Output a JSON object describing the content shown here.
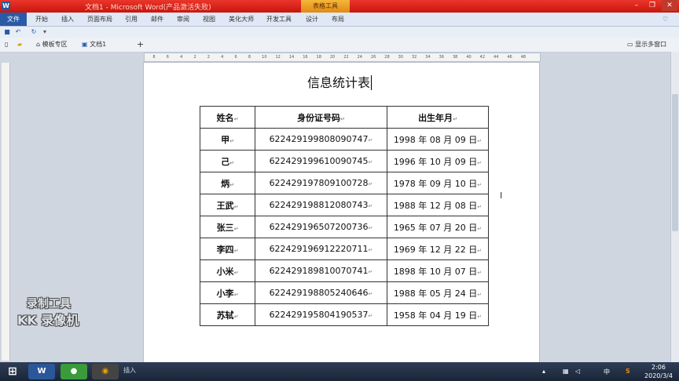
{
  "window": {
    "title": "文档1 - Microsoft Word(产品激活失败)",
    "context_tab": "表格工具"
  },
  "ribbon": {
    "file": "文件",
    "tabs": [
      "开始",
      "插入",
      "页面布局",
      "引用",
      "邮件",
      "审阅",
      "视图",
      "美化大师",
      "开发工具",
      "设计",
      "布局"
    ]
  },
  "doc_tabs": {
    "template": "模板专区",
    "doc": "文档1",
    "add": "+",
    "multi_window": "显示多窗口"
  },
  "ruler": {
    "numbers": [
      "8",
      "6",
      "4",
      "2",
      "2",
      "4",
      "6",
      "8",
      "10",
      "12",
      "14",
      "16",
      "18",
      "20",
      "22",
      "24",
      "26",
      "28",
      "30",
      "32",
      "34",
      "36",
      "38",
      "40",
      "42",
      "44",
      "46",
      "48"
    ]
  },
  "document": {
    "title": "信息统计表",
    "table": {
      "headers": [
        "姓名",
        "身份证号码",
        "出生年月"
      ],
      "rows": [
        [
          "甲",
          "622429199808090747",
          "1998 年 08 月 09 日"
        ],
        [
          "己",
          "622429199610090745",
          "1996 年 10 月 09 日"
        ],
        [
          "炳",
          "622429197809100728",
          "1978 年 09 月 10 日"
        ],
        [
          "王武",
          "622429198812080743",
          "1988 年 12 月 08 日"
        ],
        [
          "张三",
          "622429196507200736",
          "1965 年 07 月 20 日"
        ],
        [
          "李四",
          "622429196912220711",
          "1969 年 12 月 22 日"
        ],
        [
          "小米",
          "622429189810070741",
          "1898 年 10 月 07 日"
        ],
        [
          "小李",
          "622429198805240646",
          "1988 年 05 月 24 日"
        ],
        [
          "苏轼",
          "622429195804190537",
          "1958 年 04 月 19 日"
        ]
      ]
    }
  },
  "watermark": {
    "line1": "录制工具",
    "line2": "KK 录像机"
  },
  "taskbar": {
    "insert_label": "插入",
    "time": "2:06",
    "date": "2020/3/4"
  },
  "colors": {
    "titlebar": "#d4200f",
    "context_tab": "#f0a22a",
    "file_tab": "#2a5aa5",
    "taskbar": "#222f45"
  }
}
